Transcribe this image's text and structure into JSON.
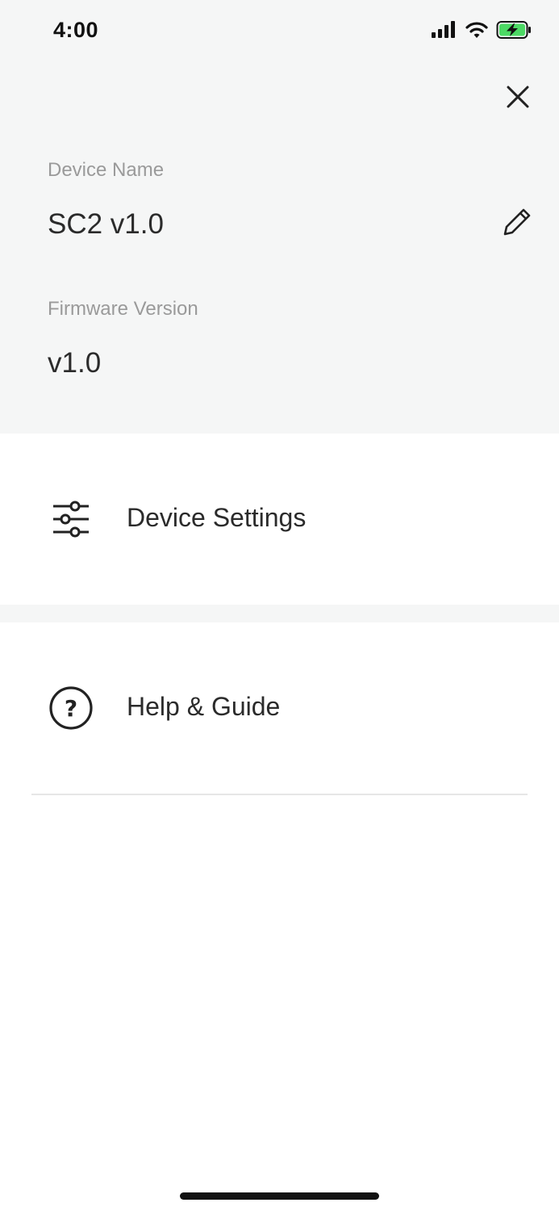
{
  "status_bar": {
    "time": "4:00",
    "icons": [
      "cellular-signal-icon",
      "wifi-icon",
      "battery-charging-icon"
    ],
    "battery_color": "#4cd964"
  },
  "header": {
    "close_icon": "close-icon",
    "device_name": {
      "label": "Device Name",
      "value": "SC2 v1.0",
      "edit_icon": "pencil-icon"
    },
    "firmware": {
      "label": "Firmware Version",
      "value": "v1.0"
    }
  },
  "menu": {
    "items": [
      {
        "label": "Device Settings",
        "icon": "sliders-icon"
      },
      {
        "label": "Help & Guide",
        "icon": "help-circle-icon"
      }
    ]
  },
  "colors": {
    "header_background": "#f5f6f6",
    "label_gray": "#9a9a9a",
    "text_dark": "#2b2b2b",
    "divider": "#e6e6e6"
  }
}
